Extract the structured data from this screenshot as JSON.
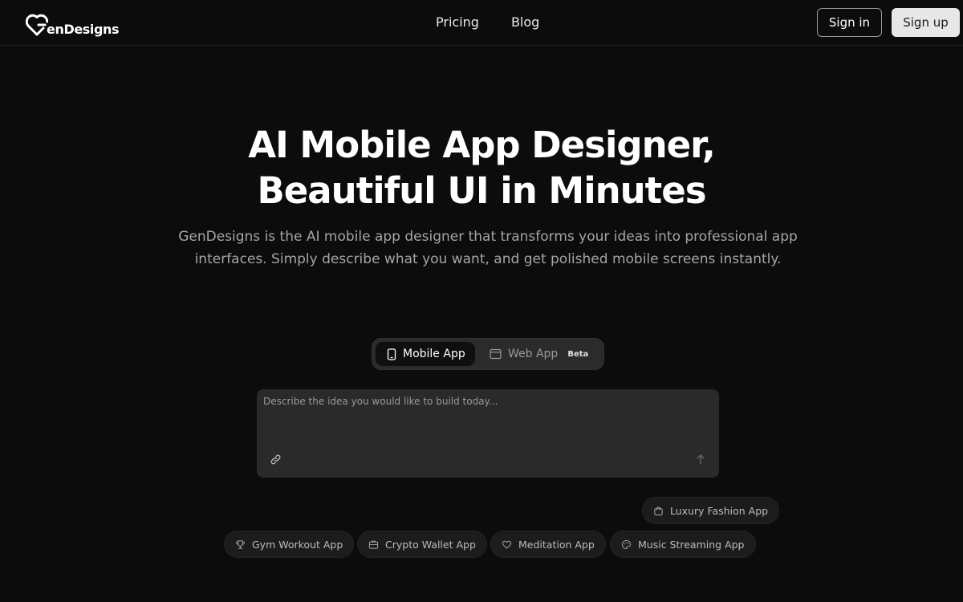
{
  "header": {
    "logo_text": "enDesigns",
    "nav": [
      {
        "label": "Pricing"
      },
      {
        "label": "Blog"
      }
    ],
    "signin_label": "Sign in",
    "signup_label": "Sign up"
  },
  "hero": {
    "title_line1": "AI Mobile App Designer,",
    "title_line2": "Beautiful UI in Minutes",
    "subtitle": "GenDesigns is the AI mobile app designer that transforms your ideas into professional app interfaces. Simply describe what you want, and get polished mobile screens instantly."
  },
  "toggle": {
    "mobile_label": "Mobile App",
    "web_label": "Web App",
    "beta_label": "Beta",
    "selected": "Mobile App"
  },
  "prompt": {
    "placeholder": "Describe the idea you would like to build today...",
    "value": ""
  },
  "suggestions": [
    {
      "label": "Luxury Fashion App",
      "icon": "shopping-bag-icon"
    },
    {
      "label": "Gym Workout App",
      "icon": "trophy-icon"
    },
    {
      "label": "Crypto Wallet App",
      "icon": "wallet-icon"
    },
    {
      "label": "Meditation App",
      "icon": "heart-icon"
    },
    {
      "label": "Music Streaming App",
      "icon": "palette-icon"
    }
  ],
  "colors": {
    "background": "#0c0c0c",
    "surface": "#2a2a2a",
    "text": "#ffffff",
    "muted": "#a5a5a5"
  }
}
